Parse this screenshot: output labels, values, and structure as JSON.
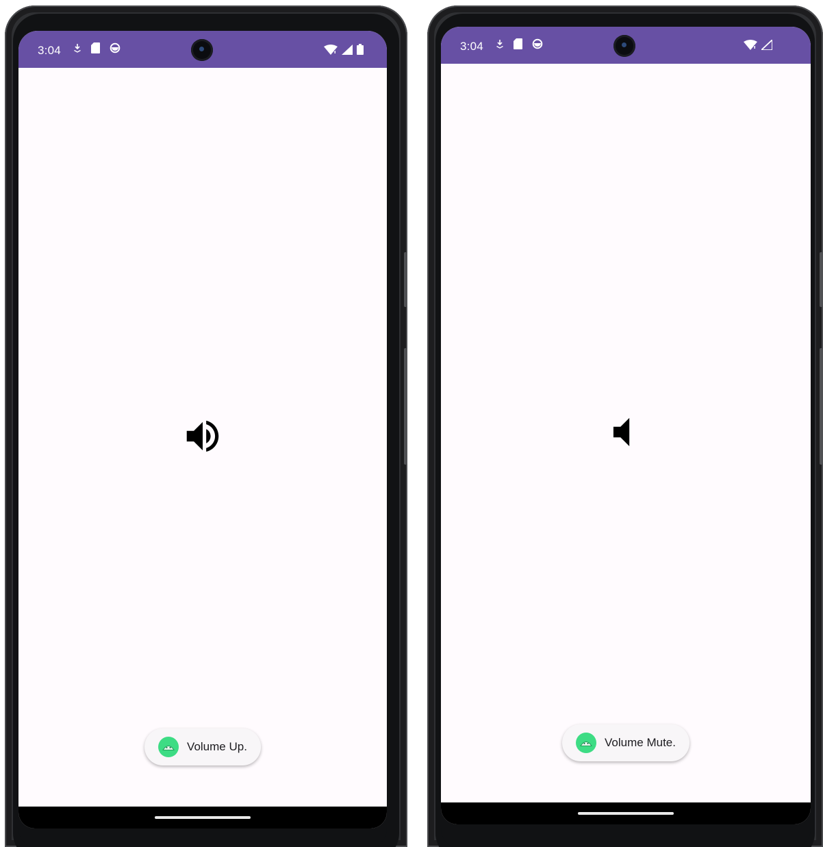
{
  "colors": {
    "status_bar": "#6750a4",
    "screen_background": "#fffbfe",
    "toast_background": "#f8f6f8",
    "toast_icon": "#3ddc84"
  },
  "phones": [
    {
      "status": {
        "time": "3:04",
        "left_icons": [
          "download-icon",
          "sd-card-icon",
          "data-saver-icon"
        ],
        "right_icons": [
          "wifi-icon",
          "cell-signal-icon",
          "battery-icon"
        ]
      },
      "main_icon": "volume-up-icon",
      "toast": {
        "icon": "android-icon",
        "text": "Volume Up."
      }
    },
    {
      "status": {
        "time": "3:04",
        "left_icons": [
          "download-icon",
          "sd-card-icon",
          "data-saver-icon"
        ],
        "right_icons": [
          "wifi-icon",
          "cell-signal-icon"
        ]
      },
      "main_icon": "volume-mute-icon",
      "toast": {
        "icon": "android-icon",
        "text": "Volume Mute."
      }
    }
  ]
}
